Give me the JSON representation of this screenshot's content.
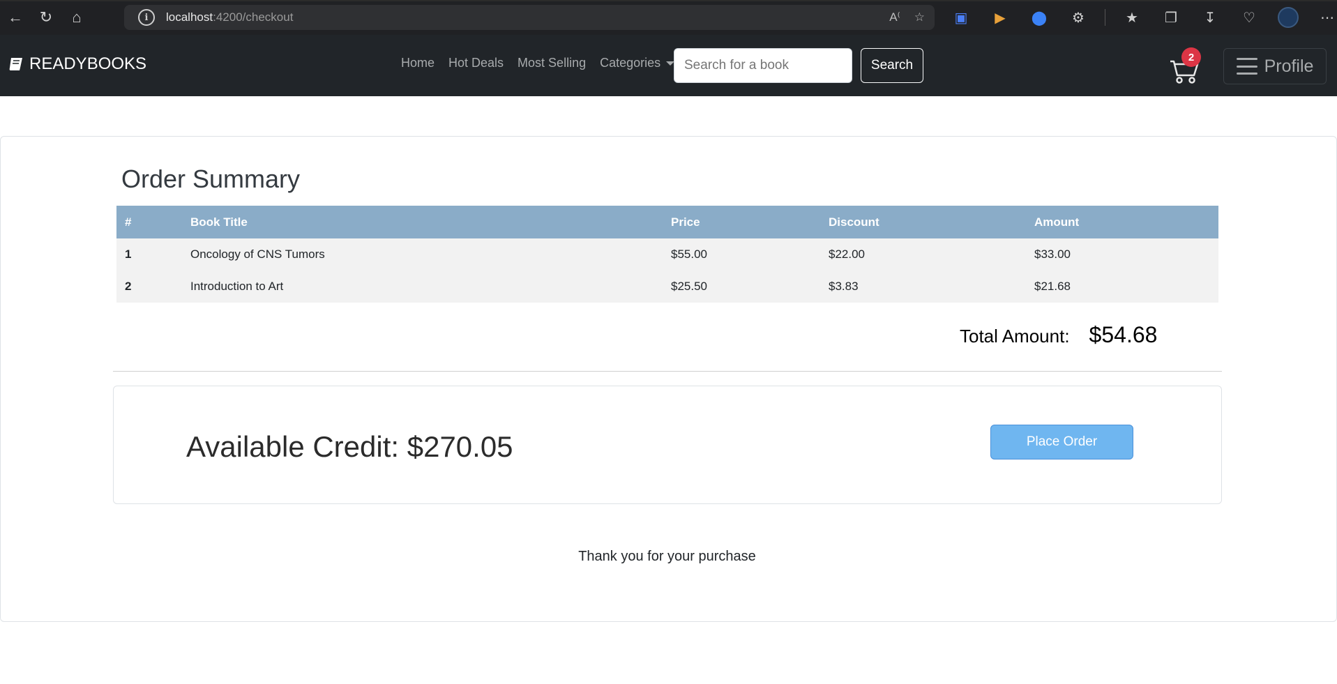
{
  "browser": {
    "url_host": "localhost",
    "url_path": ":4200/checkout"
  },
  "navbar": {
    "brand": "READYBOOKS",
    "links": [
      "Home",
      "Hot Deals",
      "Most Selling",
      "Categories"
    ],
    "search_placeholder": "Search for a book",
    "search_button": "Search",
    "cart_count": "2",
    "profile_label": "Profile"
  },
  "order": {
    "title": "Order Summary",
    "columns": [
      "#",
      "Book Title",
      "Price",
      "Discount",
      "Amount"
    ],
    "rows": [
      [
        "1",
        "Oncology of CNS Tumors",
        "$55.00",
        "$22.00",
        "$33.00"
      ],
      [
        "2",
        "Introduction to Art",
        "$25.50",
        "$3.83",
        "$21.68"
      ]
    ],
    "total_label": "Total Amount:",
    "total_value": "$54.68"
  },
  "credit": {
    "text": "Available Credit: $270.05",
    "place_order": "Place Order"
  },
  "footer_message": "Thank you for your purchase"
}
